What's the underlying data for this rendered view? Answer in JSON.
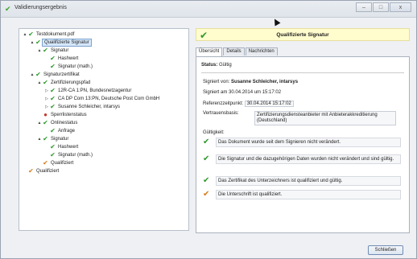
{
  "window": {
    "title": "Validierungsergebnis",
    "buttons": {
      "minimize": "–",
      "maximize": "□",
      "close": "x"
    }
  },
  "tree": {
    "items": [
      {
        "label": "Testdokument.pdf",
        "level": 0,
        "icon": "check-icon",
        "expand": "▲"
      },
      {
        "label": "Qualifizierte Signatur",
        "level": 1,
        "icon": "check-icon",
        "expand": "▲",
        "selected": true
      },
      {
        "label": "Signatur",
        "level": 2,
        "icon": "check-icon",
        "expand": "▲"
      },
      {
        "label": "Hashwert",
        "level": 3,
        "icon": "check-icon",
        "expand": ""
      },
      {
        "label": "Signatur (math.)",
        "level": 3,
        "icon": "check-icon",
        "expand": ""
      },
      {
        "label": "Signaturzertifikat",
        "level": 1,
        "icon": "check-icon",
        "expand": "▲"
      },
      {
        "label": "Zertifizierungspfad",
        "level": 2,
        "icon": "check-icon",
        "expand": "▲"
      },
      {
        "label": "12R-CA 1:PN, Bundesnetzagentur",
        "level": 3,
        "icon": "check-icon",
        "expand": "▷"
      },
      {
        "label": "CA DP Com 13:PN, Deutsche Post Com GmbH",
        "level": 3,
        "icon": "check-icon",
        "expand": "▷"
      },
      {
        "label": "Susanne Schleicher, intarsys",
        "level": 3,
        "icon": "check-icon",
        "expand": "▷"
      },
      {
        "label": "Sperrlistenstatus",
        "level": 2,
        "icon": "red-dot-icon",
        "expand": ""
      },
      {
        "label": "Onlinestatus",
        "level": 2,
        "icon": "check-icon",
        "expand": "▲"
      },
      {
        "label": "Anfrage",
        "level": 3,
        "icon": "check-icon",
        "expand": ""
      },
      {
        "label": "Signatur",
        "level": 2,
        "icon": "check-icon",
        "expand": "▲"
      },
      {
        "label": "Hashwert",
        "level": 3,
        "icon": "check-icon",
        "expand": ""
      },
      {
        "label": "Signatur (math.)",
        "level": 3,
        "icon": "check-icon",
        "expand": ""
      },
      {
        "label": "Qualifiziert",
        "level": 2,
        "icon": "orange-check-icon",
        "expand": ""
      },
      {
        "label": "Qualifiziert",
        "level": 0,
        "icon": "orange-check-icon",
        "expand": ""
      }
    ]
  },
  "header": {
    "title": "Qualifizierte Signatur"
  },
  "tabs": [
    {
      "label": "Übersicht",
      "active": true
    },
    {
      "label": "Details",
      "active": false
    },
    {
      "label": "Nachrichten",
      "active": false
    }
  ],
  "overview": {
    "status_label": "Status:",
    "status_value": "Gültig",
    "signer_label": "Signiert von:",
    "signer_value": "Susanne Schleicher, intarsys",
    "signed_at": "Signiert am 30.04.2014 um 15:17:02",
    "ref_label": "Referenzzeitpunkt:",
    "ref_value": "30.04.2014 15:17:02",
    "trust_label": "Vertrauensbasis:",
    "trust_value": "Zertifizierungsdiensteanbieter mit Anbieterakkreditierung (Deutschland)",
    "validity_label": "Gültigkeit:",
    "validity_items": [
      {
        "text": "Das Dokument wurde seit dem Signieren nicht verändert.",
        "icon": "check-icon"
      },
      {
        "text": "Die Signatur und die dazugehörigen Daten wurden nicht verändert und sind gültig.",
        "icon": "check-icon"
      },
      {
        "text": "Das Zertifikat des Unterzeichners ist qualifiziert und gültig.",
        "icon": "check-icon"
      },
      {
        "text": "Die Unterschrift ist qualifiziert.",
        "icon": "orange-check-icon"
      }
    ]
  },
  "footer": {
    "close_label": "Schließen"
  },
  "colors": {
    "accent_green": "#2e9a2e",
    "header_bg": "#fffccd",
    "orange": "#d77b19"
  }
}
